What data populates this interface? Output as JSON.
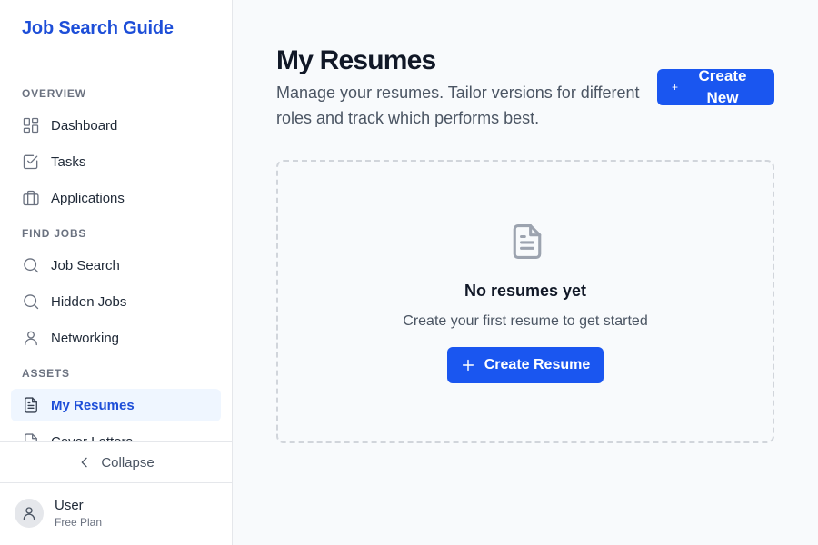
{
  "sidebar": {
    "brand": "Job Search Guide",
    "sections": [
      {
        "label": "OVERVIEW",
        "items": [
          {
            "label": "Dashboard",
            "icon": "dashboard-icon"
          },
          {
            "label": "Tasks",
            "icon": "tasks-icon"
          },
          {
            "label": "Applications",
            "icon": "briefcase-icon"
          }
        ]
      },
      {
        "label": "FIND JOBS",
        "items": [
          {
            "label": "Job Search",
            "icon": "search-icon"
          },
          {
            "label": "Hidden Jobs",
            "icon": "search-icon"
          },
          {
            "label": "Networking",
            "icon": "user-icon"
          }
        ]
      },
      {
        "label": "ASSETS",
        "items": [
          {
            "label": "My Resumes",
            "icon": "document-icon",
            "active": true
          },
          {
            "label": "Cover Letters",
            "icon": "document-icon"
          }
        ]
      }
    ],
    "collapse_label": "Collapse",
    "user": {
      "name": "User",
      "plan": "Free Plan"
    }
  },
  "main": {
    "title": "My Resumes",
    "description": "Manage your resumes. Tailor versions for different roles and track which performs best.",
    "new_version_label": "Create New Version",
    "empty": {
      "title": "No resumes yet",
      "subtitle": "Create your first resume to get started",
      "button_label": "Create Resume"
    }
  },
  "colors": {
    "brand": "#1d4ed8",
    "primary_button": "#1a56f0",
    "active_bg": "#eff6ff"
  }
}
